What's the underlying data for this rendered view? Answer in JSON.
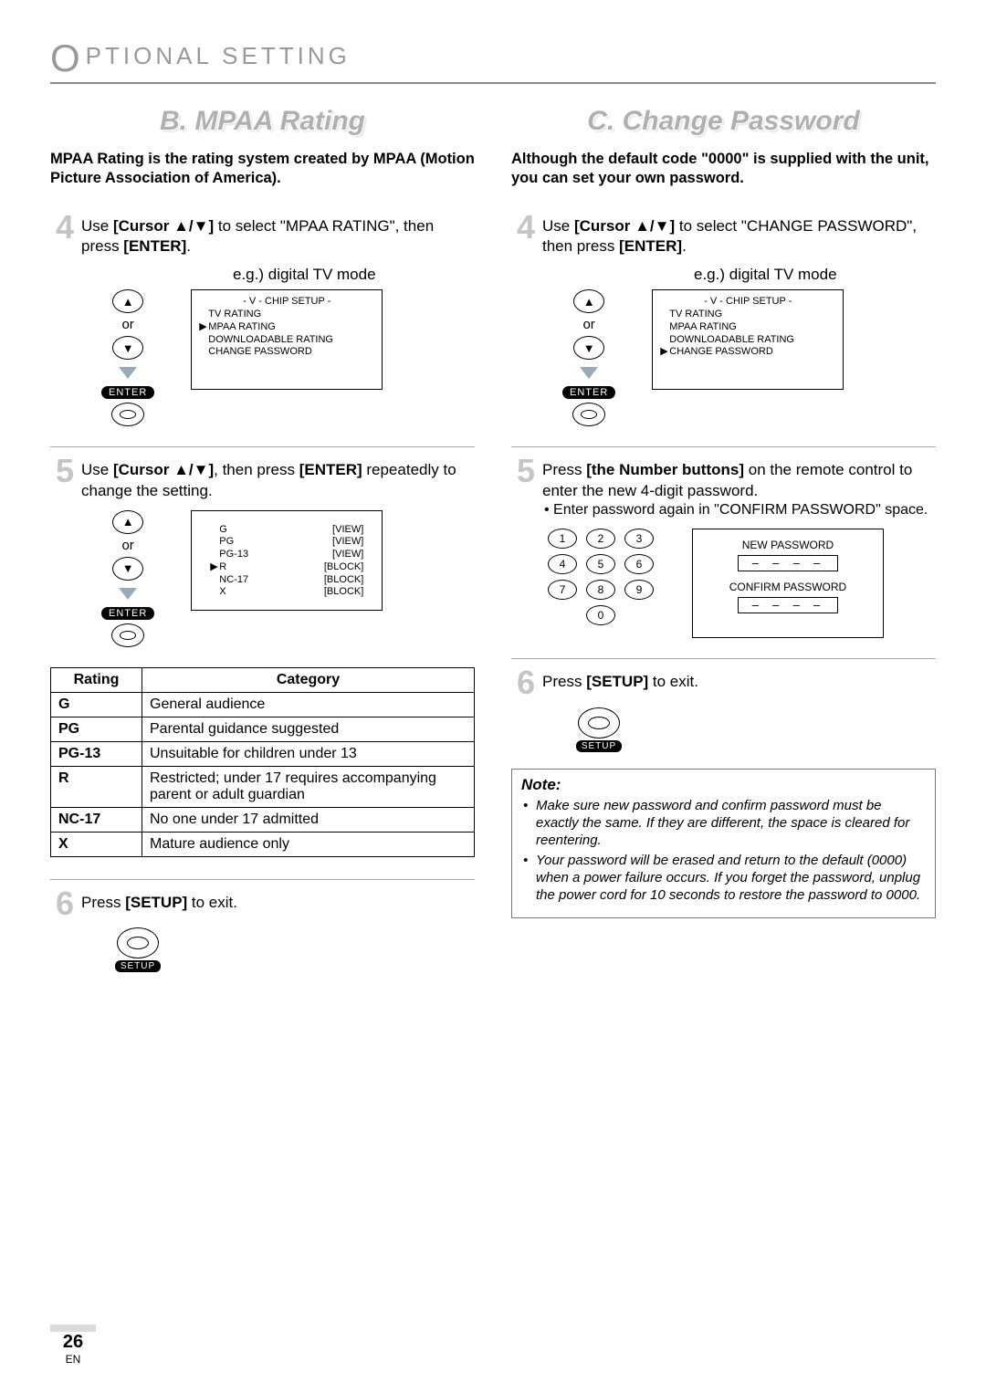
{
  "header": {
    "cap": "O",
    "rest": "PTIONAL   SETTING"
  },
  "pageNumber": "26",
  "pageLang": "EN",
  "left": {
    "title": "B.  MPAA Rating",
    "intro": "MPAA Rating is the rating system created by MPAA (Motion Picture Association of America).",
    "step4": {
      "num": "4",
      "pre": "Use ",
      "cursor": "[Cursor ▲/▼]",
      "mid": " to select \"MPAA RATING\", then press ",
      "enter": "[ENTER]",
      "post": "."
    },
    "eg": "e.g.) digital TV mode",
    "panel4": {
      "title": "- V - CHIP SETUP -",
      "items": [
        {
          "mk": "",
          "lbl": "TV RATING"
        },
        {
          "mk": "▶",
          "lbl": "MPAA RATING"
        },
        {
          "mk": "",
          "lbl": "DOWNLOADABLE RATING"
        },
        {
          "mk": "",
          "lbl": "CHANGE PASSWORD"
        }
      ]
    },
    "controls": {
      "or": "or",
      "enter": "ENTER"
    },
    "step5": {
      "num": "5",
      "pre": "Use ",
      "cursor": "[Cursor ▲/▼]",
      "mid": ", then press ",
      "enter": "[ENTER]",
      "post": " repeatedly to change the setting."
    },
    "panel5": {
      "rows": [
        {
          "mk": "",
          "lbl": "G",
          "st": "[VIEW]"
        },
        {
          "mk": "",
          "lbl": "PG",
          "st": "[VIEW]"
        },
        {
          "mk": "",
          "lbl": "PG-13",
          "st": "[VIEW]"
        },
        {
          "mk": "▶",
          "lbl": "R",
          "st": "[BLOCK]"
        },
        {
          "mk": "",
          "lbl": "NC-17",
          "st": "[BLOCK]"
        },
        {
          "mk": "",
          "lbl": "X",
          "st": "[BLOCK]"
        }
      ]
    },
    "table": {
      "headRating": "Rating",
      "headCategory": "Category",
      "rows": [
        {
          "r": "G",
          "c": "General audience"
        },
        {
          "r": "PG",
          "c": "Parental guidance suggested"
        },
        {
          "r": "PG-13",
          "c": "Unsuitable for children under 13"
        },
        {
          "r": "R",
          "c": "Restricted; under 17 requires accompanying parent or adult guardian"
        },
        {
          "r": "NC-17",
          "c": "No one under 17 admitted"
        },
        {
          "r": "X",
          "c": "Mature audience only"
        }
      ]
    },
    "step6": {
      "num": "6",
      "pre": "Press ",
      "setup": "[SETUP]",
      "post": " to exit."
    },
    "setupLabel": "SETUP"
  },
  "right": {
    "title": "C.  Change Password",
    "intro": "Although the default code \"0000\" is supplied with the unit, you can set your own password.",
    "step4": {
      "num": "4",
      "pre": "Use ",
      "cursor": "[Cursor ▲/▼]",
      "mid": " to select \"CHANGE PASSWORD\", then press ",
      "enter": "[ENTER]",
      "post": "."
    },
    "eg": "e.g.) digital TV mode",
    "panel4": {
      "title": "- V - CHIP SETUP -",
      "items": [
        {
          "mk": "",
          "lbl": "TV RATING"
        },
        {
          "mk": "",
          "lbl": "MPAA RATING"
        },
        {
          "mk": "",
          "lbl": "DOWNLOADABLE RATING"
        },
        {
          "mk": "▶",
          "lbl": "CHANGE PASSWORD"
        }
      ]
    },
    "controls": {
      "or": "or",
      "enter": "ENTER"
    },
    "step5": {
      "num": "5",
      "pre": "Press ",
      "btns": "[the Number buttons]",
      "mid": " on the remote control to enter the new 4-digit password.",
      "bullet": "Enter password again in \"CONFIRM PASSWORD\" space."
    },
    "keypad": [
      "1",
      "2",
      "3",
      "4",
      "5",
      "6",
      "7",
      "8",
      "9",
      "0"
    ],
    "pwPanel": {
      "newLabel": "NEW PASSWORD",
      "confirmLabel": "CONFIRM PASSWORD",
      "mask": "– – – –"
    },
    "step6": {
      "num": "6",
      "pre": "Press ",
      "setup": "[SETUP]",
      "post": " to exit."
    },
    "setupLabel": "SETUP",
    "note": {
      "head": "Note:",
      "items": [
        "Make sure new password and confirm password must be exactly the same. If they are different, the space is cleared for reentering.",
        "Your password will be erased and return to the default (0000) when a power failure occurs. If you forget the password, unplug the power cord for 10 seconds to restore the password to 0000."
      ]
    }
  }
}
